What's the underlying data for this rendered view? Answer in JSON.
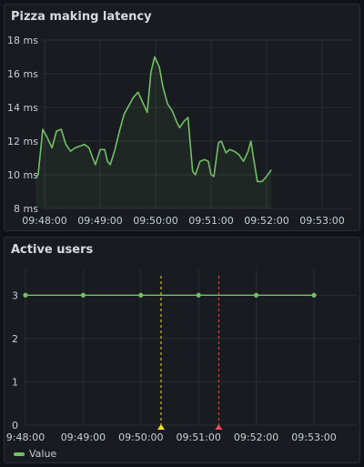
{
  "panels": {
    "latency": {
      "title": "Pizza making latency"
    },
    "users": {
      "title": "Active users",
      "legend_label": "Value"
    }
  },
  "colors": {
    "series": "#73bf69",
    "annotation_1": "#fade2a",
    "annotation_2": "#f2495c"
  },
  "chart_data": [
    {
      "type": "area",
      "title": "Pizza making latency",
      "x_ticks": [
        "09:48:00",
        "09:49:00",
        "09:50:00",
        "09:51:00",
        "09:52:00",
        "09:53:00"
      ],
      "y_ticks": [
        "8 ms",
        "10 ms",
        "12 ms",
        "14 ms",
        "16 ms",
        "18 ms"
      ],
      "ylim": [
        8,
        18
      ],
      "xlim": [
        "09:47:50",
        "09:53:40"
      ],
      "series": [
        {
          "values": [
            [
              "09:47:50",
              9.9
            ],
            [
              "09:47:53",
              10.0
            ],
            [
              "09:47:58",
              12.7
            ],
            [
              "09:48:03",
              12.2
            ],
            [
              "09:48:08",
              11.6
            ],
            [
              "09:48:13",
              12.6
            ],
            [
              "09:48:18",
              12.7
            ],
            [
              "09:48:23",
              11.8
            ],
            [
              "09:48:28",
              11.4
            ],
            [
              "09:48:33",
              11.6
            ],
            [
              "09:48:43",
              11.8
            ],
            [
              "09:48:48",
              11.6
            ],
            [
              "09:48:52",
              11.0
            ],
            [
              "09:48:55",
              10.6
            ],
            [
              "09:49:00",
              11.5
            ],
            [
              "09:49:05",
              11.5
            ],
            [
              "09:49:08",
              10.8
            ],
            [
              "09:49:11",
              10.6
            ],
            [
              "09:49:16",
              11.5
            ],
            [
              "09:49:21",
              12.6
            ],
            [
              "09:49:26",
              13.6
            ],
            [
              "09:49:31",
              14.1
            ],
            [
              "09:49:36",
              14.6
            ],
            [
              "09:49:41",
              14.9
            ],
            [
              "09:49:46",
              14.3
            ],
            [
              "09:49:51",
              13.7
            ],
            [
              "09:49:55",
              16.1
            ],
            [
              "09:49:59",
              17.0
            ],
            [
              "09:50:04",
              16.4
            ],
            [
              "09:50:08",
              15.2
            ],
            [
              "09:50:13",
              14.2
            ],
            [
              "09:50:18",
              13.8
            ],
            [
              "09:50:23",
              13.1
            ],
            [
              "09:50:26",
              12.8
            ],
            [
              "09:50:31",
              13.2
            ],
            [
              "09:50:35",
              13.4
            ],
            [
              "09:50:40",
              10.2
            ],
            [
              "09:50:43",
              10.0
            ],
            [
              "09:50:48",
              10.8
            ],
            [
              "09:50:53",
              10.9
            ],
            [
              "09:50:57",
              10.8
            ],
            [
              "09:51:00",
              10.0
            ],
            [
              "09:51:03",
              9.9
            ],
            [
              "09:51:08",
              11.9
            ],
            [
              "09:51:11",
              12.0
            ],
            [
              "09:51:16",
              11.3
            ],
            [
              "09:51:20",
              11.5
            ],
            [
              "09:51:25",
              11.4
            ],
            [
              "09:51:30",
              11.2
            ],
            [
              "09:51:35",
              10.8
            ],
            [
              "09:51:40",
              11.4
            ],
            [
              "09:51:43",
              12.0
            ],
            [
              "09:51:47",
              10.6
            ],
            [
              "09:51:50",
              9.6
            ],
            [
              "09:51:55",
              9.6
            ],
            [
              "09:52:00",
              9.9
            ],
            [
              "09:52:05",
              10.3
            ]
          ]
        }
      ]
    },
    {
      "type": "line",
      "title": "Active users",
      "x_ticks": [
        "9:48:00",
        "09:49:00",
        "09:50:00",
        "09:51:00",
        "09:52:00",
        "09:53:00"
      ],
      "y_ticks": [
        "0",
        "1",
        "2",
        "3"
      ],
      "ylim": [
        0,
        3.3
      ],
      "series": [
        {
          "name": "Value",
          "x": [
            "09:48:00",
            "09:49:00",
            "09:50:00",
            "09:51:00",
            "09:52:00",
            "09:53:00"
          ],
          "values": [
            3,
            3,
            3,
            3,
            3,
            3
          ]
        }
      ],
      "annotations": [
        {
          "x": "09:50:21",
          "color": "#fade2a"
        },
        {
          "x": "09:51:21",
          "color": "#f2495c"
        }
      ]
    }
  ]
}
